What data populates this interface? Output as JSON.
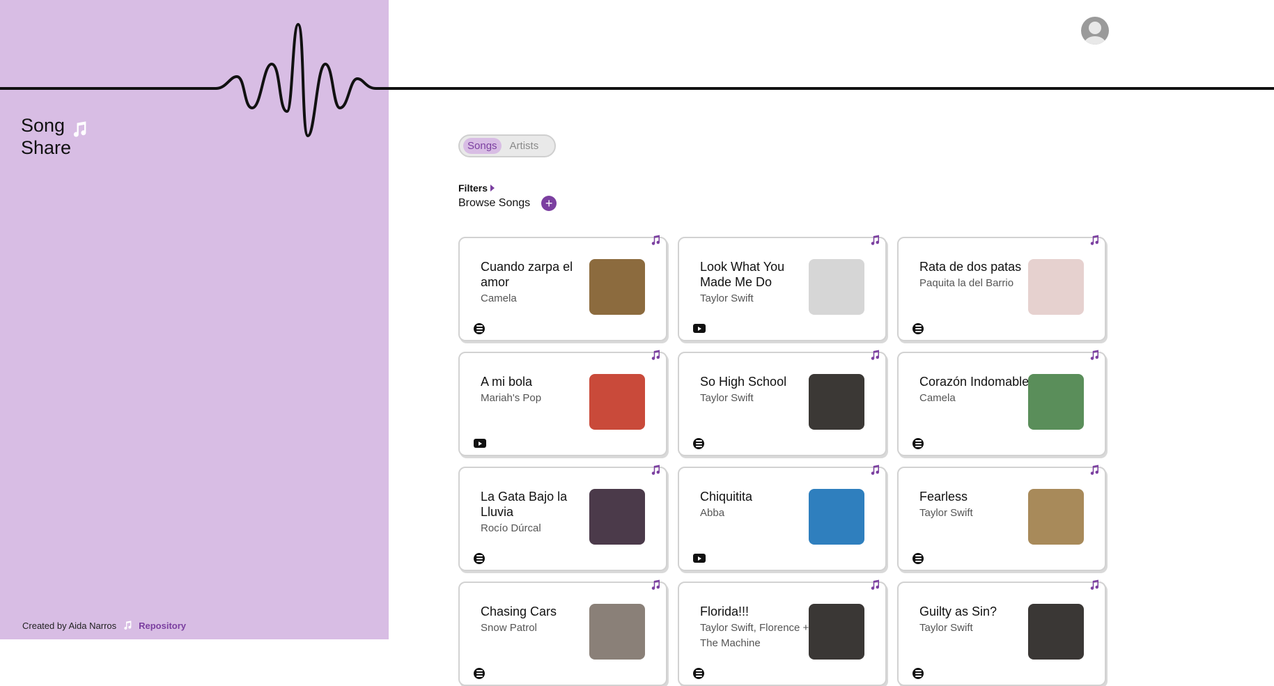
{
  "app": {
    "logo_line1": "Song",
    "logo_line2": "Share"
  },
  "footer": {
    "credit": "Created by Aida Narros",
    "repo_label": "Repository"
  },
  "tabs": [
    {
      "label": "Songs",
      "active": true
    },
    {
      "label": "Artists",
      "active": false
    }
  ],
  "filters_label": "Filters",
  "browse_label": "Browse Songs",
  "icons": {
    "logo": "music-note-icon",
    "avatar": "user-avatar-icon",
    "pin": "music-note-icon",
    "add": "plus-icon"
  },
  "colors": {
    "sidebar": "#d8bde4",
    "accent": "#7b3fa0"
  },
  "songs": [
    {
      "title": "Cuando zarpa el amor",
      "artist": "Camela",
      "source": "spotify",
      "cover": "#8c6b3e"
    },
    {
      "title": "Look What You Made Me Do",
      "artist": "Taylor Swift",
      "source": "youtube",
      "cover": "#d6d6d6"
    },
    {
      "title": "Rata de dos patas",
      "artist": "Paquita la del Barrio",
      "source": "spotify",
      "cover": "#e6d1cf"
    },
    {
      "title": "A mi bola",
      "artist": "Mariah's Pop",
      "source": "youtube",
      "cover": "#c94a3a"
    },
    {
      "title": "So High School",
      "artist": "Taylor Swift",
      "source": "spotify",
      "cover": "#3b3835"
    },
    {
      "title": "Corazón Indomable",
      "artist": "Camela",
      "source": "spotify",
      "cover": "#5a8e5a"
    },
    {
      "title": "La Gata Bajo la Lluvia",
      "artist": "Rocío Dúrcal",
      "source": "spotify",
      "cover": "#4b3a4a"
    },
    {
      "title": "Chiquitita",
      "artist": "Abba",
      "source": "youtube",
      "cover": "#2f7fbe"
    },
    {
      "title": "Fearless",
      "artist": "Taylor Swift",
      "source": "spotify",
      "cover": "#a88a5a"
    },
    {
      "title": "Chasing Cars",
      "artist": "Snow Patrol",
      "source": "spotify",
      "cover": "#8a8078"
    },
    {
      "title": "Florida!!!",
      "artist": "Taylor Swift, Florence + The Machine",
      "source": "spotify",
      "cover": "#3a3735"
    },
    {
      "title": "Guilty as Sin?",
      "artist": "Taylor Swift",
      "source": "spotify",
      "cover": "#3a3735"
    }
  ]
}
